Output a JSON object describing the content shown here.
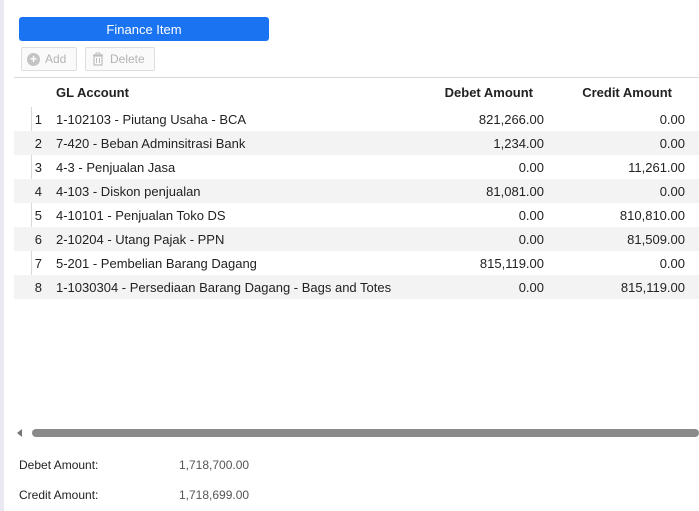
{
  "panel": {
    "title": "Finance Item"
  },
  "toolbar": {
    "add_label": "Add",
    "delete_label": "Delete",
    "add_icon": "plus-circle-icon",
    "delete_icon": "trash-icon"
  },
  "grid": {
    "columns": {
      "gl": "GL Account",
      "debet": "Debet Amount",
      "credit": "Credit Amount"
    },
    "rows": [
      {
        "num": "1",
        "gl": "1-102103 - Piutang Usaha - BCA",
        "debet": "821,266.00",
        "credit": "0.00"
      },
      {
        "num": "2",
        "gl": "7-420 - Beban Adminsitrasi Bank",
        "debet": "1,234.00",
        "credit": "0.00"
      },
      {
        "num": "3",
        "gl": "4-3 - Penjualan Jasa",
        "debet": "0.00",
        "credit": "11,261.00"
      },
      {
        "num": "4",
        "gl": "4-103 - Diskon penjualan",
        "debet": "81,081.00",
        "credit": "0.00"
      },
      {
        "num": "5",
        "gl": "4-10101 - Penjualan Toko DS",
        "debet": "0.00",
        "credit": "810,810.00"
      },
      {
        "num": "6",
        "gl": "2-10204 - Utang Pajak - PPN",
        "debet": "0.00",
        "credit": "81,509.00"
      },
      {
        "num": "7",
        "gl": "5-201 - Pembelian Barang Dagang",
        "debet": "815,119.00",
        "credit": "0.00"
      },
      {
        "num": "8",
        "gl": "1-1030304 - Persediaan Barang Dagang - Bags and Totes",
        "debet": "0.00",
        "credit": "815,119.00"
      }
    ]
  },
  "summary": {
    "debet_label": "Debet Amount:",
    "debet_value": "1,718,700.00",
    "credit_label": "Credit Amount:",
    "credit_value": "1,718,699.00"
  },
  "colors": {
    "header_bg": "#1a73f0",
    "alt_row": "#f3f3f3"
  }
}
